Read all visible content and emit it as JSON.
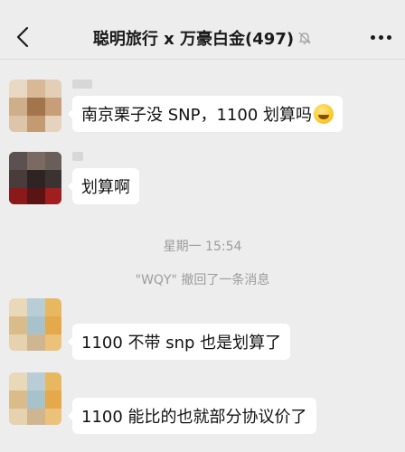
{
  "header": {
    "title": "聪明旅行 x 万豪白金(497)",
    "back_icon": "chevron-left-icon",
    "mute_icon": "bell-off-icon",
    "more_icon": "ellipsis-icon"
  },
  "messages": [
    {
      "text": "南京栗子没 SNP，1100 划算吗",
      "emoji": "laughing-tears-emoji"
    },
    {
      "text": "划算啊"
    },
    {
      "text": "1100 不带 snp 也是划算了"
    },
    {
      "text": "1100 能比的也就部分协议价了"
    }
  ],
  "timestamp": "星期一 15:54",
  "system_notice": "\"WQY\" 撤回了一条消息",
  "colors": {
    "background": "#ededed",
    "bubble": "#ffffff",
    "meta_text": "#9c9c9c"
  }
}
